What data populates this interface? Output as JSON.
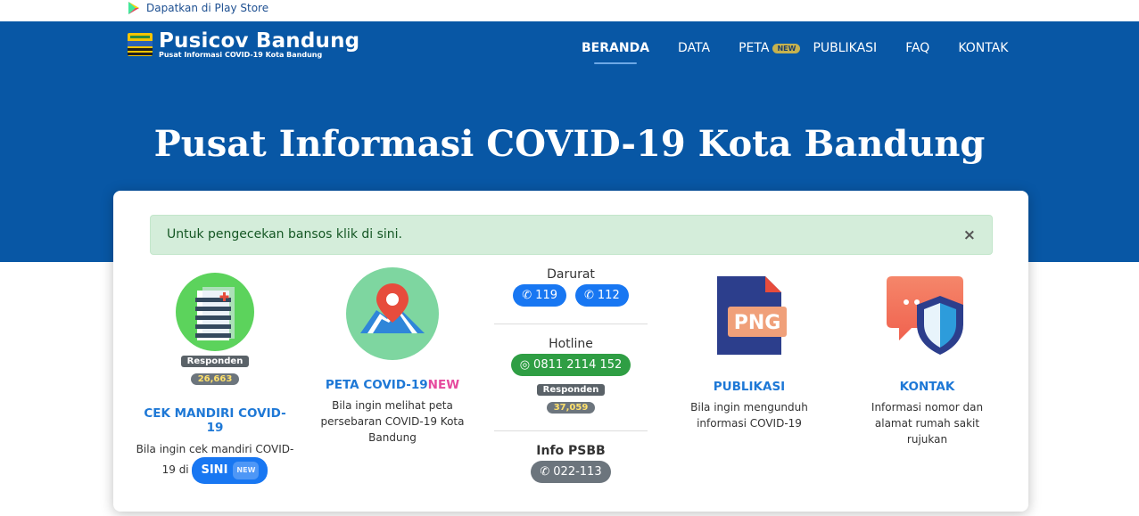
{
  "topbar": {
    "play_store": "Dapatkan di Play Store"
  },
  "brand": {
    "name": "Pusicov Bandung",
    "subtitle": "Pusat Informasi COVID-19 Kota Bandung"
  },
  "nav": {
    "items": [
      {
        "label": "BERANDA",
        "active": true
      },
      {
        "label": "DATA"
      },
      {
        "label": "PETA",
        "tag": "NEW"
      },
      {
        "label": "PUBLIKASI"
      },
      {
        "label": "FAQ"
      },
      {
        "label": "KONTAK"
      }
    ]
  },
  "hero": {
    "title": "Pusat Informasi COVID-19 Kota Bandung"
  },
  "alert": {
    "text": "Untuk pengecekan bansos klik di sini.",
    "close": "×"
  },
  "cek_mandiri": {
    "badge": "Responden",
    "count": "26,663",
    "title": "CEK MANDIRI COVID-19",
    "desc": "Bila ingin cek mandiri COVID-19 di",
    "button": "SINI",
    "button_tag": "NEW"
  },
  "peta": {
    "title": "PETA COVID-19",
    "title_tag": "NEW",
    "desc": "Bila ingin melihat peta persebaran COVID-19 Kota Bandung"
  },
  "contacts": {
    "darurat": {
      "label": "Darurat",
      "numbers": [
        "119",
        "112"
      ]
    },
    "hotline": {
      "label": "Hotline",
      "number": "0811 2114 152",
      "badge": "Responden",
      "count": "37,059"
    },
    "psbb": {
      "label": "Info PSBB",
      "number": "022-113"
    }
  },
  "publikasi": {
    "icon_text": "PNG",
    "title": "PUBLIKASI",
    "desc": "Bila ingin mengunduh informasi COVID-19"
  },
  "kontak": {
    "title": "KONTAK",
    "desc": "Informasi nomor dan alamat rumah sakit rujukan"
  },
  "colors": {
    "nav_bg": "#0857a5",
    "accent": "#1e78d6",
    "alert_bg": "#d4edda",
    "alert_text": "#155724",
    "new_pink": "#e64a9e"
  }
}
